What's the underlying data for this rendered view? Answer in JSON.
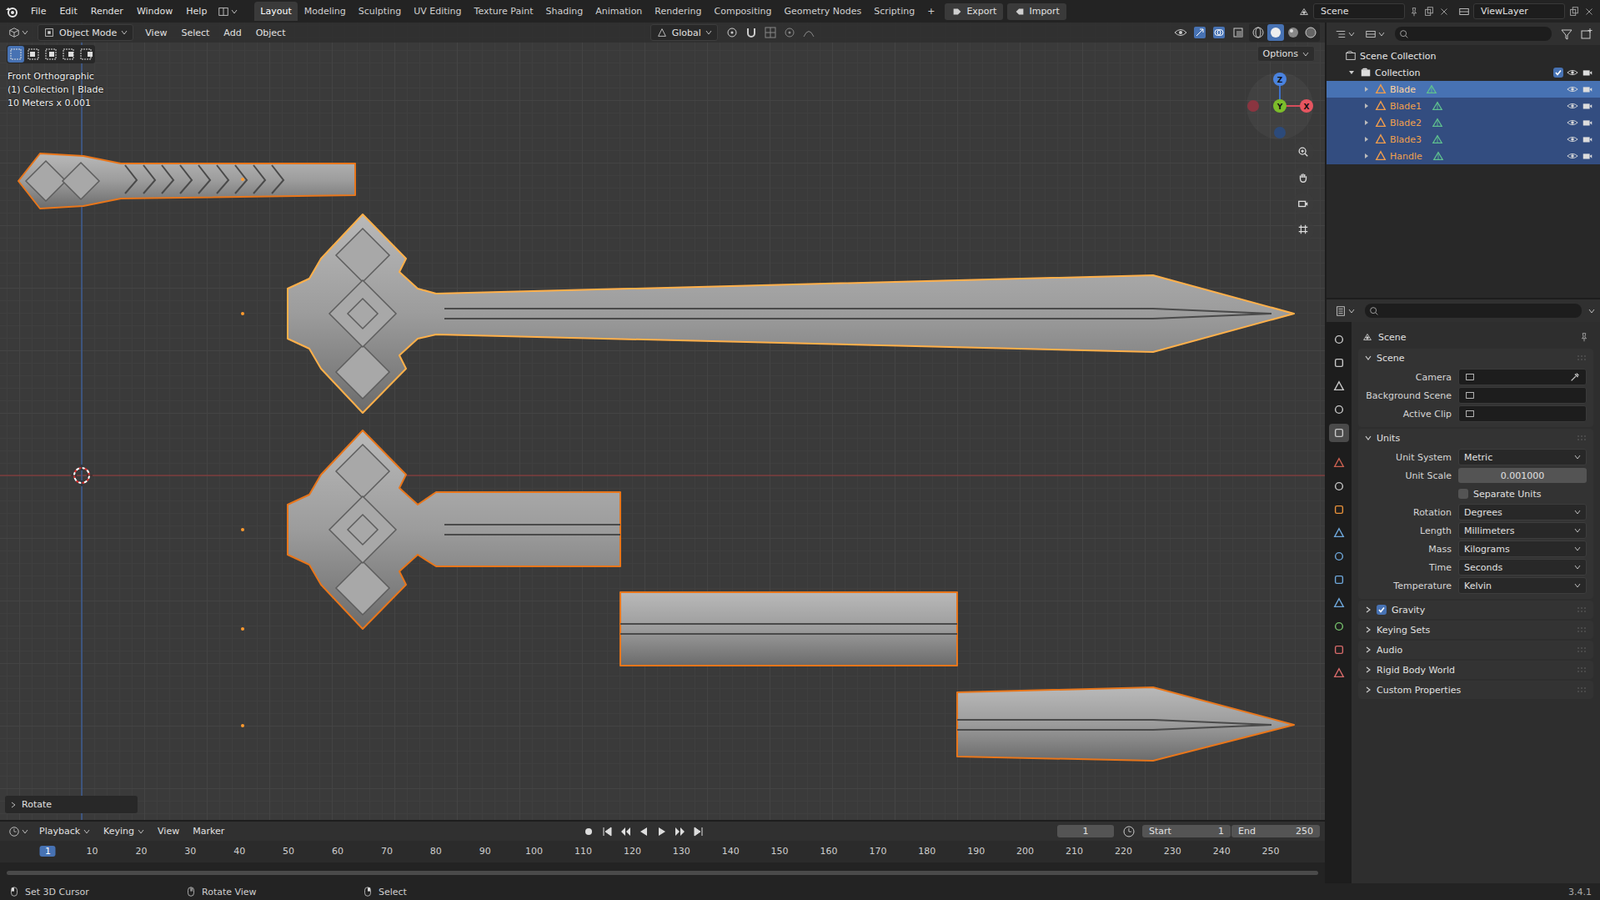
{
  "topbar": {
    "menus": [
      "File",
      "Edit",
      "Render",
      "Window",
      "Help"
    ],
    "workspaces": [
      {
        "label": "Layout",
        "selected": true
      },
      {
        "label": "Modeling",
        "selected": false
      },
      {
        "label": "Sculpting",
        "selected": false
      },
      {
        "label": "UV Editing",
        "selected": false
      },
      {
        "label": "Texture Paint",
        "selected": false
      },
      {
        "label": "Shading",
        "selected": false
      },
      {
        "label": "Animation",
        "selected": false
      },
      {
        "label": "Rendering",
        "selected": false
      },
      {
        "label": "Compositing",
        "selected": false
      },
      {
        "label": "Geometry Nodes",
        "selected": false
      },
      {
        "label": "Scripting",
        "selected": false
      }
    ],
    "add_workspace": "+",
    "actions": [
      "Export",
      "Import"
    ],
    "scene": "Scene",
    "view_layer": "ViewLayer"
  },
  "viewport": {
    "mode": "Object Mode",
    "menus": [
      "View",
      "Select",
      "Add",
      "Object"
    ],
    "orientation": "Global",
    "options": "Options",
    "overlay": [
      "Front Orthographic",
      "(1) Collection | Blade",
      "10 Meters x 0.001"
    ],
    "gizmo": [
      "X",
      "Y",
      "Z"
    ],
    "last_operator": "Rotate"
  },
  "outliner": {
    "root": "Scene Collection",
    "collection": "Collection",
    "collection_checked": true,
    "items": [
      {
        "name": "Blade",
        "selected": true,
        "active": true
      },
      {
        "name": "Blade1",
        "selected": true,
        "active": false
      },
      {
        "name": "Blade2",
        "selected": true,
        "active": false
      },
      {
        "name": "Blade3",
        "selected": true,
        "active": false
      },
      {
        "name": "Handle",
        "selected": true,
        "active": false
      }
    ]
  },
  "properties": {
    "context": "Scene",
    "tabs": [
      {
        "selected": false
      },
      {
        "selected": false
      },
      {
        "selected": false
      },
      {
        "selected": false
      },
      {
        "selected": true
      },
      {
        "selected": false
      },
      {
        "selected": false
      },
      {
        "selected": false
      },
      {
        "selected": false
      },
      {
        "selected": false
      },
      {
        "selected": false
      },
      {
        "selected": false
      },
      {
        "selected": false
      },
      {
        "selected": false
      },
      {
        "selected": false
      }
    ],
    "panels": [
      {
        "title": "Scene",
        "expanded": true,
        "kind": "plain",
        "rows": [
          {
            "kind": "picker",
            "label": "Camera",
            "value": "",
            "eyedropper": true
          },
          {
            "kind": "picker",
            "label": "Background Scene",
            "value": "",
            "eyedropper": false
          },
          {
            "kind": "picker",
            "label": "Active Clip",
            "value": "",
            "eyedropper": false
          }
        ]
      },
      {
        "title": "Units",
        "expanded": true,
        "kind": "plain",
        "rows": [
          {
            "kind": "dropdown",
            "label": "Unit System",
            "value": "Metric"
          },
          {
            "kind": "number",
            "label": "Unit Scale",
            "value": "0.001000"
          },
          {
            "kind": "checkbox",
            "label": "Separate Units",
            "checked": false
          },
          {
            "kind": "dropdown",
            "label": "Rotation",
            "value": "Degrees"
          },
          {
            "kind": "dropdown",
            "label": "Length",
            "value": "Millimeters"
          },
          {
            "kind": "dropdown",
            "label": "Mass",
            "value": "Kilograms"
          },
          {
            "kind": "dropdown",
            "label": "Time",
            "value": "Seconds"
          },
          {
            "kind": "dropdown",
            "label": "Temperature",
            "value": "Kelvin"
          }
        ]
      },
      {
        "title": "Gravity",
        "expanded": false,
        "kind": "toggle",
        "checked": true,
        "rows": []
      },
      {
        "title": "Keying Sets",
        "expanded": false,
        "kind": "plain",
        "rows": []
      },
      {
        "title": "Audio",
        "expanded": false,
        "kind": "plain",
        "rows": []
      },
      {
        "title": "Rigid Body World",
        "expanded": false,
        "kind": "plain",
        "rows": []
      },
      {
        "title": "Custom Properties",
        "expanded": false,
        "kind": "plain",
        "rows": []
      }
    ]
  },
  "timeline": {
    "menus": [
      "Playback",
      "Keying",
      "View",
      "Marker"
    ],
    "current_frame": "1",
    "start_label": "Start",
    "start": "1",
    "end_label": "End",
    "end": "250",
    "ticks": [
      {
        "label": "1",
        "selected": true
      },
      {
        "label": "10",
        "selected": false
      },
      {
        "label": "20",
        "selected": false
      },
      {
        "label": "30",
        "selected": false
      },
      {
        "label": "40",
        "selected": false
      },
      {
        "label": "50",
        "selected": false
      },
      {
        "label": "60",
        "selected": false
      },
      {
        "label": "70",
        "selected": false
      },
      {
        "label": "80",
        "selected": false
      },
      {
        "label": "90",
        "selected": false
      },
      {
        "label": "100",
        "selected": false
      },
      {
        "label": "110",
        "selected": false
      },
      {
        "label": "120",
        "selected": false
      },
      {
        "label": "130",
        "selected": false
      },
      {
        "label": "140",
        "selected": false
      },
      {
        "label": "150",
        "selected": false
      },
      {
        "label": "160",
        "selected": false
      },
      {
        "label": "170",
        "selected": false
      },
      {
        "label": "180",
        "selected": false
      },
      {
        "label": "190",
        "selected": false
      },
      {
        "label": "200",
        "selected": false
      },
      {
        "label": "210",
        "selected": false
      },
      {
        "label": "220",
        "selected": false
      },
      {
        "label": "230",
        "selected": false
      },
      {
        "label": "240",
        "selected": false
      },
      {
        "label": "250",
        "selected": false
      }
    ]
  },
  "status_bar": {
    "items": [
      "Set 3D Cursor",
      "Rotate View",
      "Select"
    ],
    "version": "3.4.1"
  }
}
